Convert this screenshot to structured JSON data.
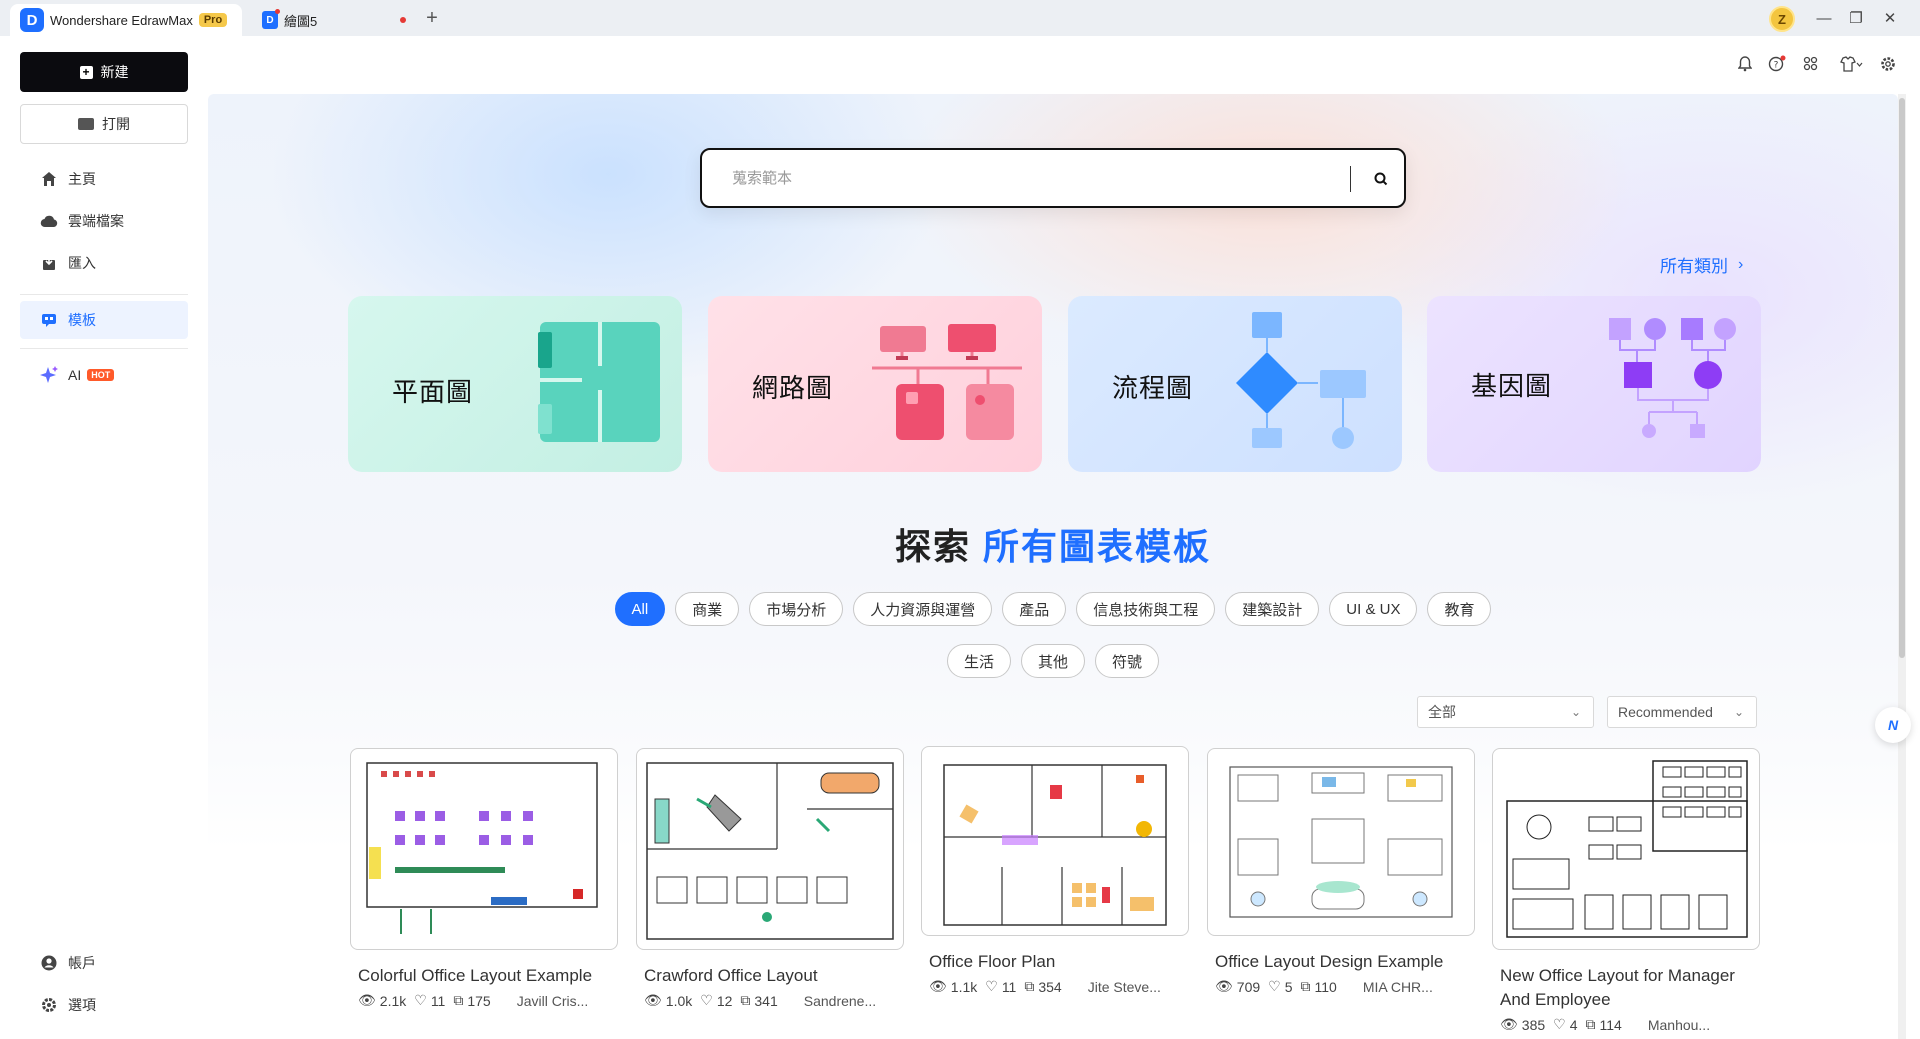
{
  "titlebar": {
    "app_name": "Wondershare EdrawMax",
    "pro_label": "Pro",
    "doc_tab": "繪圖5",
    "add_tab": "+",
    "avatar_initial": "Z",
    "minimize": "—",
    "maximize": "❐",
    "close": "✕"
  },
  "sidebar": {
    "new_label": "新建",
    "open_label": "打開",
    "nav": [
      {
        "label": "主頁",
        "icon": "home-icon"
      },
      {
        "label": "雲端檔案",
        "icon": "cloud-icon"
      },
      {
        "label": "匯入",
        "icon": "import-icon"
      },
      {
        "label": "模板",
        "icon": "template-icon",
        "active": true
      },
      {
        "label": "AI",
        "icon": "ai-sparkle-icon",
        "badge": "HOT"
      }
    ],
    "bottom": [
      {
        "label": "帳戶",
        "icon": "account-icon"
      },
      {
        "label": "選項",
        "icon": "settings-icon"
      }
    ]
  },
  "search": {
    "placeholder": "蒐索範本"
  },
  "all_categories": "所有類別",
  "categories": [
    {
      "label": "平面圖",
      "bg": "#c9f1e6",
      "accent": "#4fd1b6"
    },
    {
      "label": "網路圖",
      "bg": "#ffd6e0",
      "accent": "#f46b86"
    },
    {
      "label": "流程圖",
      "bg": "#d4e6ff",
      "accent": "#2f8bff"
    },
    {
      "label": "基因圖",
      "bg": "#e6dcff",
      "accent": "#9a5bff"
    }
  ],
  "explore": {
    "prefix": "探索",
    "highlight": "所有圖表模板"
  },
  "filter_chips_row1": [
    "All",
    "商業",
    "市場分析",
    "人力資源與運營",
    "產品",
    "信息技術與工程",
    "建築設計",
    "UI & UX",
    "教育"
  ],
  "filter_chips_row2": [
    "生活",
    "其他",
    "符號"
  ],
  "filters": {
    "scope": "全部",
    "sort": "Recommended"
  },
  "templates": [
    {
      "title": "Colorful Office Layout Example",
      "views": "2.1k",
      "likes": "11",
      "copies": "175",
      "author": "Javill Cris..."
    },
    {
      "title": "Crawford Office Layout",
      "views": "1.0k",
      "likes": "12",
      "copies": "341",
      "author": "Sandrene..."
    },
    {
      "title": "Office Floor Plan",
      "views": "1.1k",
      "likes": "11",
      "copies": "354",
      "author": "Jite Steve..."
    },
    {
      "title": "Office Layout Design Example",
      "views": "709",
      "likes": "5",
      "copies": "110",
      "author": "MIA CHR..."
    },
    {
      "title": "New Office Layout for Manager And Employee",
      "views": "385",
      "likes": "4",
      "copies": "114",
      "author": "Manhou..."
    }
  ],
  "floating_assistant": "N"
}
